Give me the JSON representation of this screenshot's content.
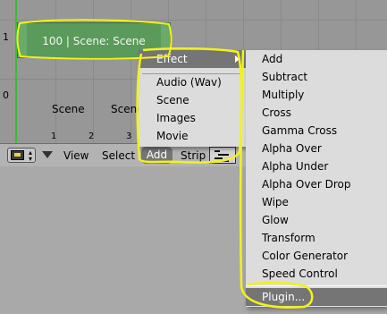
{
  "sequencer": {
    "row_labels": [
      "1",
      "0"
    ],
    "strip_label": "100 | Scene: Scene",
    "scene_labels": [
      "Scene",
      "Scene"
    ],
    "ruler_ticks": [
      "1",
      "2",
      "3"
    ]
  },
  "header": {
    "menus": {
      "view": "View",
      "select": "Select",
      "add": "Add",
      "strip": "Strip"
    }
  },
  "add_menu": {
    "effect": "Effect",
    "items": [
      "Audio (Wav)",
      "Scene",
      "Images",
      "Movie"
    ]
  },
  "effect_menu": {
    "items": [
      "Add",
      "Subtract",
      "Multiply",
      "Cross",
      "Gamma Cross",
      "Alpha Over",
      "Alpha Under",
      "Alpha Over Drop",
      "Wipe",
      "Glow",
      "Transform",
      "Color Generator",
      "Speed Control"
    ],
    "plugin": "Plugin..."
  },
  "colors": {
    "highlight": "#f2f21a",
    "menu_active": "#757575",
    "strip_green": "#5a9a5a",
    "frame_line": "#3cb93c"
  }
}
